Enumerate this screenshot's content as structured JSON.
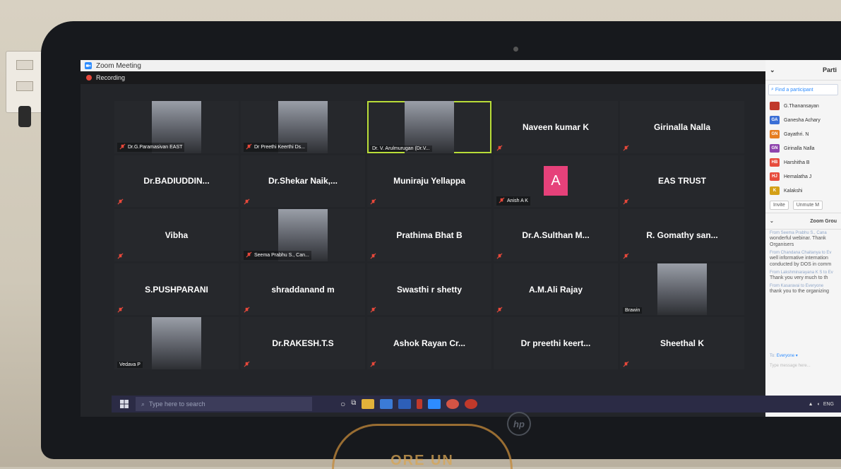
{
  "window": {
    "title": "Zoom Meeting",
    "recording_label": "Recording"
  },
  "grid": {
    "tiles": [
      {
        "name": "Dr.G.Paramasivan EAST",
        "type": "video",
        "muted": true
      },
      {
        "name": "Dr Preethi Keerthi Ds...",
        "type": "video",
        "muted": true
      },
      {
        "name": "Dr. V. Arulmurugan (Dr.V...",
        "type": "video",
        "muted": false,
        "active": true
      },
      {
        "name": "Naveen kumar K",
        "type": "name",
        "muted": true
      },
      {
        "name": "Girinalla Nalla",
        "type": "name",
        "muted": true
      },
      {
        "name": "Dr.BADIUDDIN...",
        "type": "name",
        "muted": true
      },
      {
        "name": "Dr.Shekar  Naik,...",
        "type": "name",
        "muted": true
      },
      {
        "name": "Muniraju Yellappa",
        "type": "name",
        "muted": true
      },
      {
        "name": "Anish A K",
        "type": "avatar",
        "avatar_letter": "A",
        "avatar_color": "#e6417a",
        "muted": true
      },
      {
        "name": "EAS TRUST",
        "type": "name",
        "muted": true
      },
      {
        "name": "Vibha",
        "type": "name",
        "muted": true
      },
      {
        "name": "Seema Prabhu S., Can...",
        "type": "video",
        "muted": true
      },
      {
        "name": "Prathima Bhat B",
        "type": "name",
        "muted": true
      },
      {
        "name": "Dr.A.Sulthan  M...",
        "type": "name",
        "muted": true
      },
      {
        "name": "R. Gomathy san...",
        "type": "name",
        "muted": true
      },
      {
        "name": "S.PUSHPARANI",
        "type": "name",
        "muted": true
      },
      {
        "name": "shraddanand m",
        "type": "name",
        "muted": true
      },
      {
        "name": "Swasthi r shetty",
        "type": "name",
        "muted": true
      },
      {
        "name": "A.M.Ali Rajay",
        "type": "name",
        "muted": true
      },
      {
        "name": "Brawin",
        "type": "video",
        "muted": false
      },
      {
        "name": "Vedava P",
        "type": "video",
        "muted": false
      },
      {
        "name": "Dr.RAKESH.T.S",
        "type": "name",
        "muted": true
      },
      {
        "name": "Ashok Rayan Cr...",
        "type": "name",
        "muted": true
      },
      {
        "name": "Dr preethi keert...",
        "type": "name",
        "muted": false
      },
      {
        "name": "Sheethal K",
        "type": "name",
        "muted": true
      }
    ]
  },
  "participants": {
    "title": "Parti",
    "search_placeholder": "Find a participant",
    "list": [
      {
        "initials": "",
        "name": "G.Thanansayan",
        "color": "#c0392b"
      },
      {
        "initials": "GA",
        "name": "Ganesha Achary",
        "color": "#3b6fd6"
      },
      {
        "initials": "GN",
        "name": "Gayathri. N",
        "color": "#e67e22"
      },
      {
        "initials": "GN",
        "name": "Girinalla Nalla",
        "color": "#8e44ad"
      },
      {
        "initials": "HB",
        "name": "Harshitha B",
        "color": "#e74c3c"
      },
      {
        "initials": "HJ",
        "name": "Hemalatha J",
        "color": "#e74c3c"
      },
      {
        "initials": "K",
        "name": "Kalakshi",
        "color": "#d4a017"
      }
    ],
    "invite_label": "Invite",
    "unmute_label": "Unmute M"
  },
  "chat": {
    "title": "Zoom Grou",
    "messages": [
      {
        "from": "From Seema Prabhu S., Cana",
        "text": "wonderful webinar. Thank Organisers"
      },
      {
        "from": "From Chandana Chaitanya to Ev",
        "text": "well informative internation conducted by DOS in comm"
      },
      {
        "from": "From Lakshminarayana K S to Ev",
        "text": "Thank you very much to th"
      },
      {
        "from": "From Kasaravai to Everyone",
        "text": "thank you to the organizing"
      }
    ],
    "to_label": "To:",
    "to_value": "Everyone",
    "input_placeholder": "Type message here..."
  },
  "taskbar": {
    "search_placeholder": "Type here to search",
    "lang": "ENG"
  },
  "branding": {
    "laptop_logo": "hp",
    "watermark_text": "ORE UN"
  }
}
